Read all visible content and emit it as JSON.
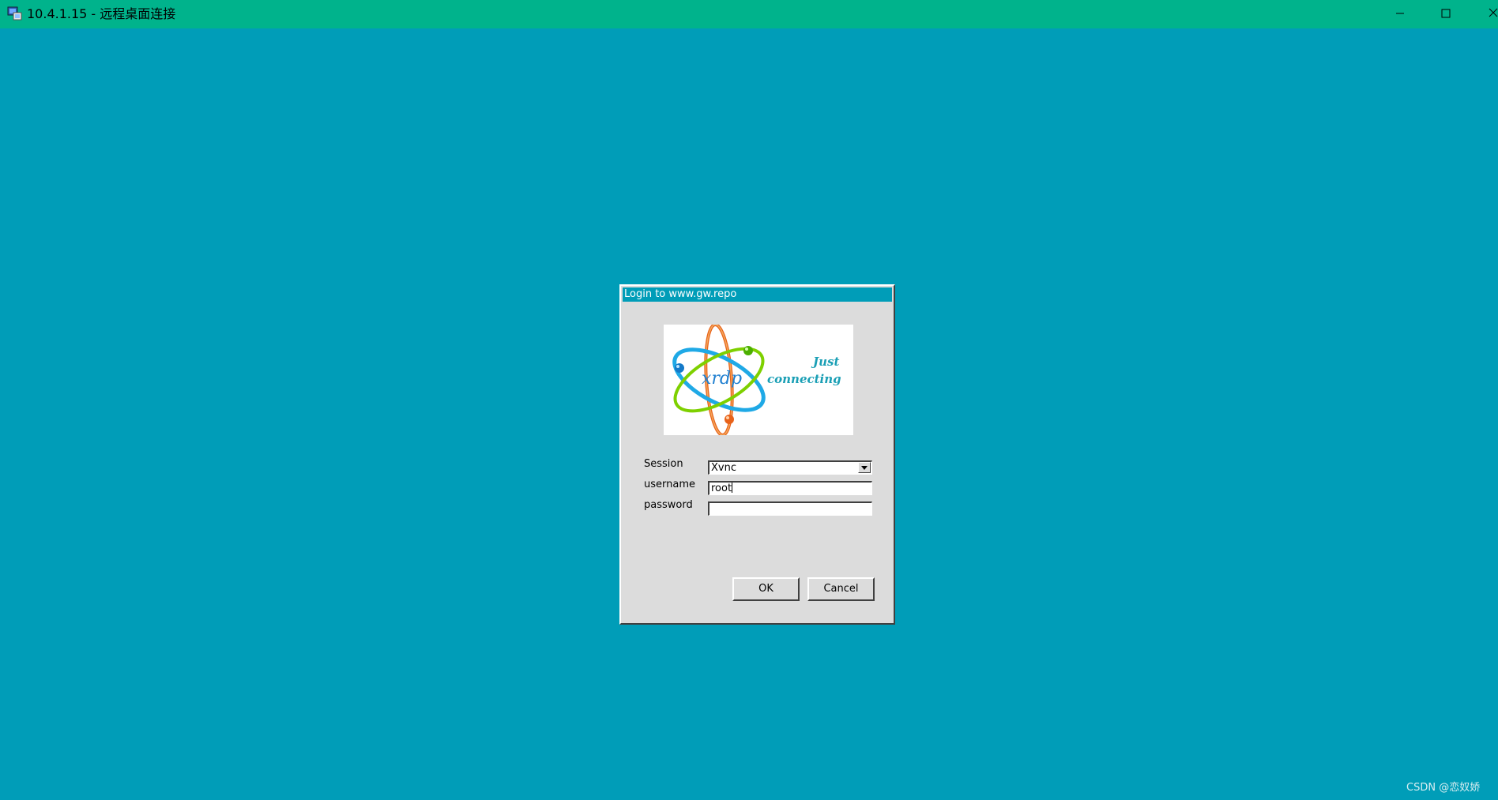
{
  "window": {
    "title": "10.4.1.15 - 远程桌面连接",
    "controls": {
      "minimize_icon": "minimize-icon",
      "maximize_icon": "maximize-icon",
      "close_icon": "close-icon"
    }
  },
  "colors": {
    "desktop_bg": "#009db8",
    "titlebar_bg": "#00b38c",
    "dialog_bg": "#dcdcdc",
    "dialog_title_bg": "#009db8"
  },
  "dialog": {
    "title": "Login to www.gw.repo",
    "logo": {
      "brand": "xrdp",
      "tagline_line1": "Just",
      "tagline_line2": "connecting"
    },
    "fields": {
      "session_label": "Session",
      "session_value": "Xvnc",
      "username_label": "username",
      "username_value": "root",
      "password_label": "password",
      "password_value": ""
    },
    "buttons": {
      "ok": "OK",
      "cancel": "Cancel"
    }
  },
  "watermark": "CSDN @恋奴娇"
}
